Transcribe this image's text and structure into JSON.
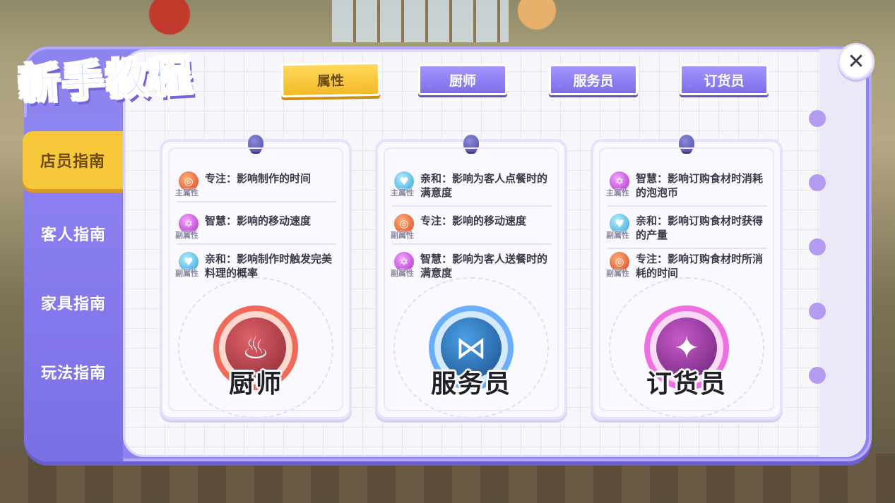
{
  "window": {
    "title": "新手教程",
    "close_label": "✕"
  },
  "sidebar": {
    "items": [
      {
        "label": "店员指南",
        "active": true
      },
      {
        "label": "客人指南",
        "active": false
      },
      {
        "label": "家具指南",
        "active": false
      },
      {
        "label": "玩法指南",
        "active": false
      }
    ]
  },
  "tabs": [
    {
      "label": "属性",
      "active": true
    },
    {
      "label": "厨师",
      "active": false
    },
    {
      "label": "服务员",
      "active": false
    },
    {
      "label": "订货员",
      "active": false
    }
  ],
  "cards": [
    {
      "role": "厨师",
      "attributes": [
        {
          "tag": "主属性",
          "icon": "focus-icon",
          "text": "专注：影响制作的时间"
        },
        {
          "tag": "副属性",
          "icon": "wisdom-icon",
          "text": "智慧：影响的移动速度"
        },
        {
          "tag": "副属性",
          "icon": "affinity-icon",
          "text": "亲和：影响制作时触发完美料理的概率"
        }
      ]
    },
    {
      "role": "服务员",
      "attributes": [
        {
          "tag": "主属性",
          "icon": "affinity-icon",
          "text": "亲和：影响为客人点餐时的满意度"
        },
        {
          "tag": "副属性",
          "icon": "focus-icon",
          "text": "专注：影响的移动速度"
        },
        {
          "tag": "副属性",
          "icon": "wisdom-icon",
          "text": "智慧：影响为客人送餐时的满意度"
        }
      ]
    },
    {
      "role": "订货员",
      "attributes": [
        {
          "tag": "主属性",
          "icon": "wisdom-icon",
          "text": "智慧：影响订购食材时消耗的泡泡币"
        },
        {
          "tag": "副属性",
          "icon": "affinity-icon",
          "text": "亲和：影响订购食材时获得的产量"
        },
        {
          "tag": "副属性",
          "icon": "focus-icon",
          "text": "专注：影响订购食材时所消耗的时间"
        }
      ]
    }
  ],
  "colors": {
    "panel": "#8e84f0",
    "accent_yellow": "#f7c83a",
    "chef": "#f06a5a",
    "waiter": "#6aaeff",
    "orderer": "#ee6fe0"
  }
}
